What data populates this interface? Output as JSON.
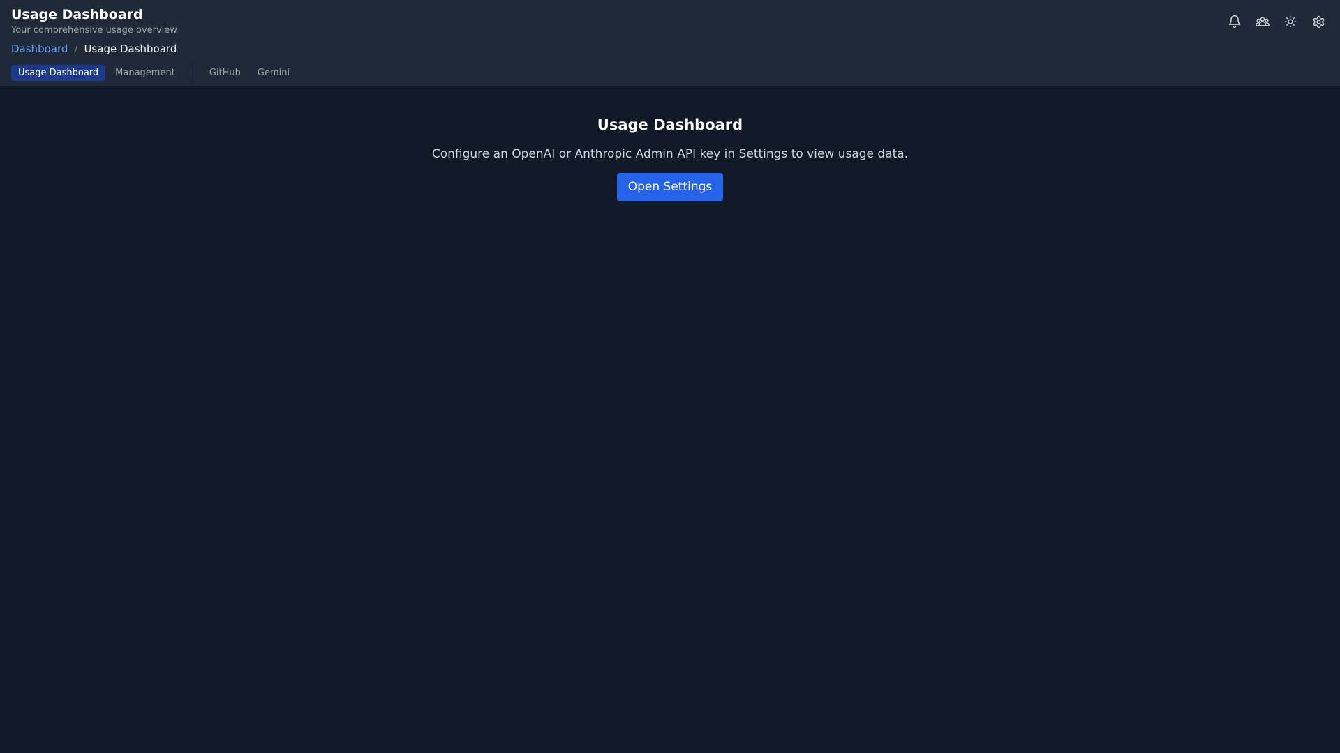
{
  "header": {
    "title": "Usage Dashboard",
    "subtitle": "Your comprehensive usage overview",
    "breadcrumb": {
      "parent": "Dashboard",
      "separator": "/",
      "current": "Usage Dashboard"
    },
    "tabs": [
      {
        "label": "Usage Dashboard",
        "active": true
      },
      {
        "label": "Management",
        "active": false
      },
      {
        "label": "GitHub",
        "active": false
      },
      {
        "label": "Gemini",
        "active": false
      }
    ],
    "icons": [
      "bell-icon",
      "team-icon",
      "sun-icon",
      "gear-icon"
    ]
  },
  "main": {
    "title": "Usage Dashboard",
    "message": "Configure an OpenAI or Anthropic Admin API key in Settings to view usage data.",
    "button_label": "Open Settings"
  },
  "colors": {
    "background": "#111827",
    "header_background": "#1f2937",
    "accent": "#2563eb",
    "active_tab": "#1e3a8a",
    "link": "#60a5fa"
  }
}
